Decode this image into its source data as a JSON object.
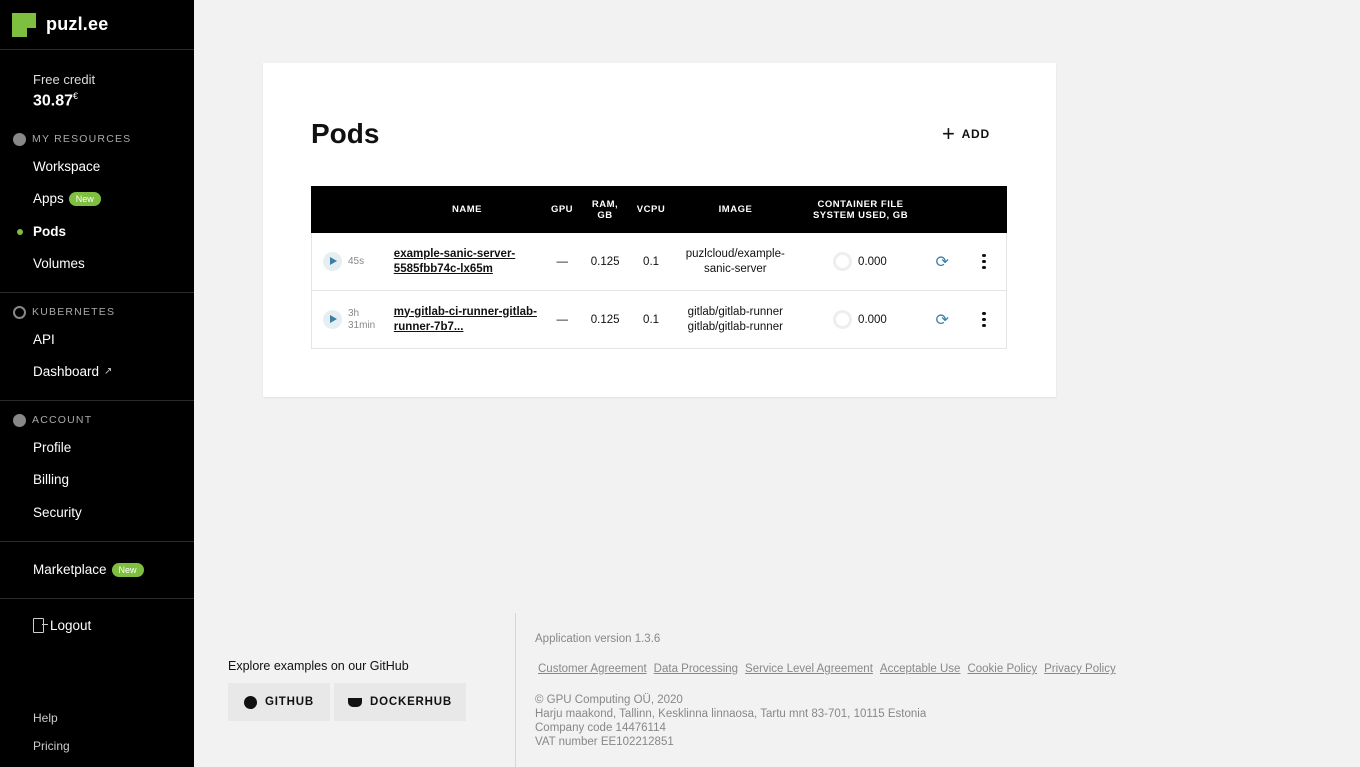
{
  "brand": {
    "name": "puzl.ee"
  },
  "credit": {
    "label": "Free credit",
    "value": "30.87",
    "currency": "€"
  },
  "sections": {
    "resources": "MY RESOURCES",
    "kubernetes": "KUBERNETES",
    "account": "ACCOUNT"
  },
  "nav": {
    "workspace": "Workspace",
    "apps": "Apps",
    "apps_badge": "New",
    "pods": "Pods",
    "volumes": "Volumes",
    "api": "API",
    "dashboard": "Dashboard",
    "profile": "Profile",
    "billing": "Billing",
    "security": "Security",
    "marketplace": "Marketplace",
    "marketplace_badge": "New",
    "logout": "Logout",
    "help": "Help",
    "pricing": "Pricing"
  },
  "page": {
    "title": "Pods",
    "add_label": "ADD"
  },
  "table": {
    "headers": {
      "name": "NAME",
      "gpu": "GPU",
      "ram_1": "RAM,",
      "ram_2": "GB",
      "vcpu": "VCPU",
      "image": "IMAGE",
      "fs_1": "CONTAINER FILE",
      "fs_2": "SYSTEM USED, GB"
    },
    "rows": [
      {
        "uptime_1": "45s",
        "uptime_2": "",
        "name_1": "example-sanic-server-",
        "name_2": "5585fbb74c-lx65m",
        "gpu": "—",
        "ram": "0.125",
        "vcpu": "0.1",
        "image_1": "puzlcloud/example-",
        "image_2": "sanic-server",
        "fs": "0.000"
      },
      {
        "uptime_1": "3h",
        "uptime_2": "31min",
        "name_1": "my-gitlab-ci-runner-gitlab-",
        "name_2": "runner-7b7...",
        "gpu": "—",
        "ram": "0.125",
        "vcpu": "0.1",
        "image_1": "gitlab/gitlab-runner",
        "image_2": "gitlab/gitlab-runner",
        "fs": "0.000"
      }
    ]
  },
  "footer": {
    "explore": "Explore examples on our GitHub",
    "github": "GITHUB",
    "dockerhub": "DOCKERHUB",
    "version": "Application version 1.3.6",
    "links": [
      "Customer Agreement",
      "Data Processing",
      "Service Level Agreement",
      "Acceptable Use",
      "Cookie Policy",
      "Privacy Policy"
    ],
    "copyright": "© GPU Computing OÜ, 2020",
    "address": "Harju maakond, Tallinn, Kesklinna linnaosa, Tartu mnt 83-701, 10115 Estonia",
    "company_code": "Company code 14476114",
    "vat": "VAT number EE102212851"
  },
  "colors": {
    "accent": "#7fbf3f",
    "sidebar_bg": "#000000",
    "link_blue": "#3a7fa8"
  }
}
